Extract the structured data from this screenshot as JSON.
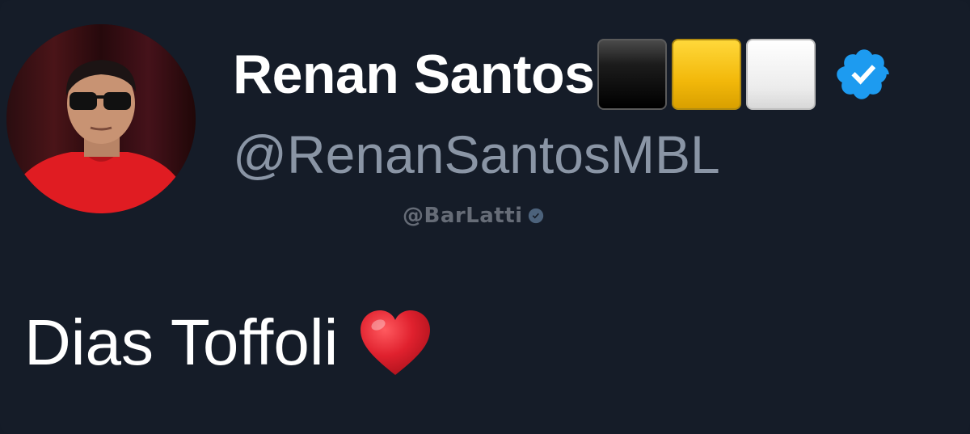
{
  "tweet": {
    "author": {
      "display_name": "Renan Santos",
      "handle": "@RenanSantosMBL",
      "verified": true,
      "verified_color": "#1d9bf0",
      "name_emoji": [
        "black-square",
        "yellow-square",
        "white-square"
      ],
      "avatar_icon": "profile-photo"
    },
    "text": "Dias Toffoli",
    "text_emoji": "red-heart",
    "heart_color": "#e0212e"
  },
  "watermark": {
    "text": "@BarLatti",
    "badge_icon": "verified-badge-icon"
  },
  "colors": {
    "background": "#151c28",
    "name": "#ffffff",
    "handle": "#8a95a5"
  }
}
